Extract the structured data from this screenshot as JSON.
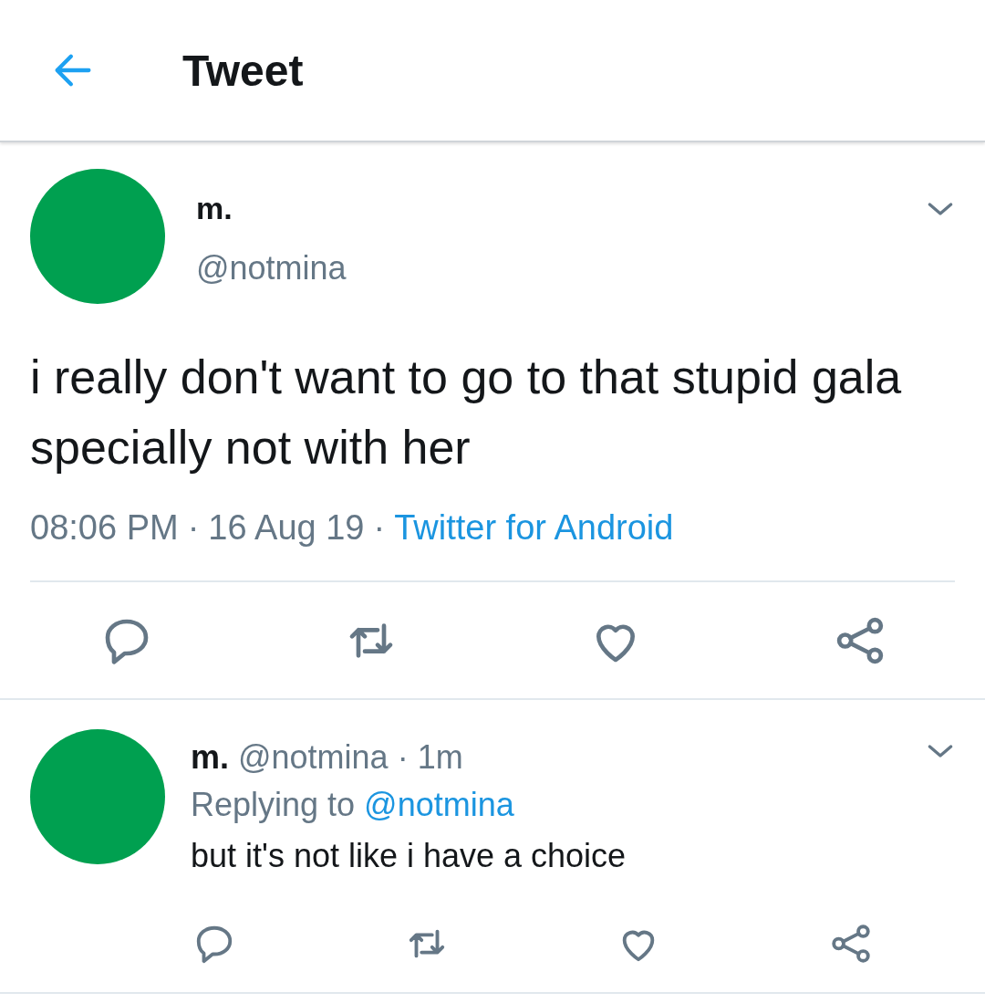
{
  "header": {
    "title": "Tweet"
  },
  "tweet": {
    "name": "m.",
    "handle": "@notmina",
    "text": "i really don't want to go to that stupid gala specially not with her",
    "meta": [
      {
        "kind": "text",
        "text": "08:06 PM"
      },
      {
        "kind": "sep",
        "text": "·"
      },
      {
        "kind": "text",
        "text": "16 Aug 19"
      },
      {
        "kind": "sep",
        "text": "·"
      },
      {
        "kind": "link",
        "text": "Twitter for Android"
      }
    ]
  },
  "reply": {
    "name": "m.",
    "handle": "@notmina",
    "sep": "·",
    "age": "1m",
    "replying_label": "Replying to",
    "replying_to": "@notmina",
    "text": "but it's not like i have a choice"
  }
}
